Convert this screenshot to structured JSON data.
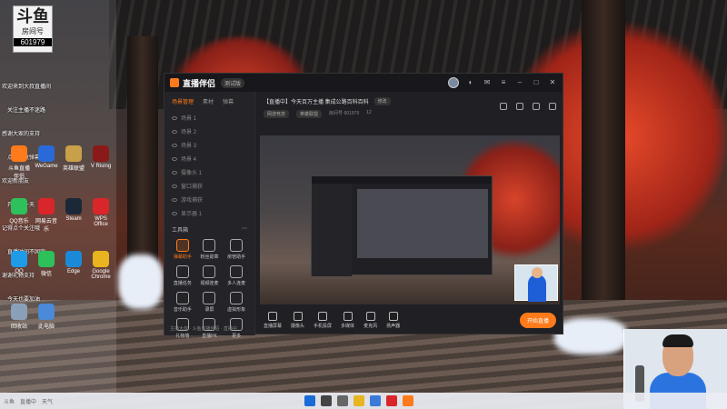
{
  "desktop": {
    "douyu_tag": {
      "logo": "斗鱼",
      "sub": "房间号",
      "room_no": "601979"
    },
    "side_texts": [
      "欢迎来到大叔直播间",
      "关注主播不迷路",
      "感谢大家的支持",
      "点歌请发弹幕",
      "欢迎新朋友",
      "开心每一天",
      "记得点个关注哦",
      "直播时间不固定",
      "谢谢礼物支持",
      "今天也要加油"
    ],
    "icons": [
      {
        "label": "斗鱼直播伴侣",
        "color": "#ff7a1a"
      },
      {
        "label": "WeGame",
        "color": "#2a6ad8"
      },
      {
        "label": "英雄联盟",
        "color": "#c8a04a"
      },
      {
        "label": "V Rising",
        "color": "#8a1a1a"
      },
      {
        "label": "QQ音乐",
        "color": "#2ec05a"
      },
      {
        "label": "网易云音乐",
        "color": "#d8262a"
      },
      {
        "label": "Steam",
        "color": "#1b2838"
      },
      {
        "label": "WPS Office",
        "color": "#d8262a"
      },
      {
        "label": "QQ",
        "color": "#1e9ce8"
      },
      {
        "label": "微信",
        "color": "#2ec05a"
      },
      {
        "label": "Edge",
        "color": "#1a8ad8"
      },
      {
        "label": "Google Chrome",
        "color": "#e8b420"
      },
      {
        "label": "回收站",
        "color": "#8aa0b8"
      },
      {
        "label": "此电脑",
        "color": "#4a8ad8"
      }
    ]
  },
  "app": {
    "brand": "直播伴侣",
    "version_tag": "测试版",
    "left_tabs": [
      "场景管理",
      "素材",
      "弹幕"
    ],
    "scenes": [
      "场景 1",
      "场景 2",
      "场景 3",
      "场景 4",
      "摄像头 1",
      "窗口捕获",
      "游戏捕获",
      "显示器 1"
    ],
    "tools_title": "工具箱",
    "tools": [
      "弹幕助手",
      "粉丝勋章",
      "房管助手",
      "直播任务",
      "视频连麦",
      "多人连麦",
      "音乐助手",
      "录屏",
      "虚拟形象",
      "礼物墙",
      "直播PK",
      "更多"
    ],
    "footer_note": "主播大叔 · 斗鱼直播伴侣 · 直播中",
    "room": {
      "title": "【直播中】今天百万主播 集成公路百科百科",
      "edit": "修改",
      "category": "网游竞技",
      "sub_category": "英雄联盟",
      "room_label": "房间号",
      "room_no": "601979",
      "viewers": "12"
    },
    "bottom_buttons": [
      "直播屏幕",
      "摄像头",
      "手机投屏",
      "多媒体",
      "麦克风",
      "扬声器"
    ],
    "start_label": "开始直播"
  },
  "colors": {
    "accent": "#ff7a1a",
    "app_bg": "#1f1f24",
    "taskbar": "#ebeef4"
  },
  "taskbar": {
    "left_items": [
      "斗鱼",
      "直播中",
      "天气"
    ],
    "pinned": [
      {
        "name": "windows-start-icon",
        "color": "#1a6ad8"
      },
      {
        "name": "search-icon",
        "color": "#444"
      },
      {
        "name": "task-view-icon",
        "color": "#666"
      },
      {
        "name": "file-explorer-icon",
        "color": "#e8b420"
      },
      {
        "name": "store-icon",
        "color": "#3a7ad8"
      },
      {
        "name": "chrome-icon",
        "color": "#d8262a"
      },
      {
        "name": "douyu-icon",
        "color": "#ff7a1a"
      }
    ]
  }
}
